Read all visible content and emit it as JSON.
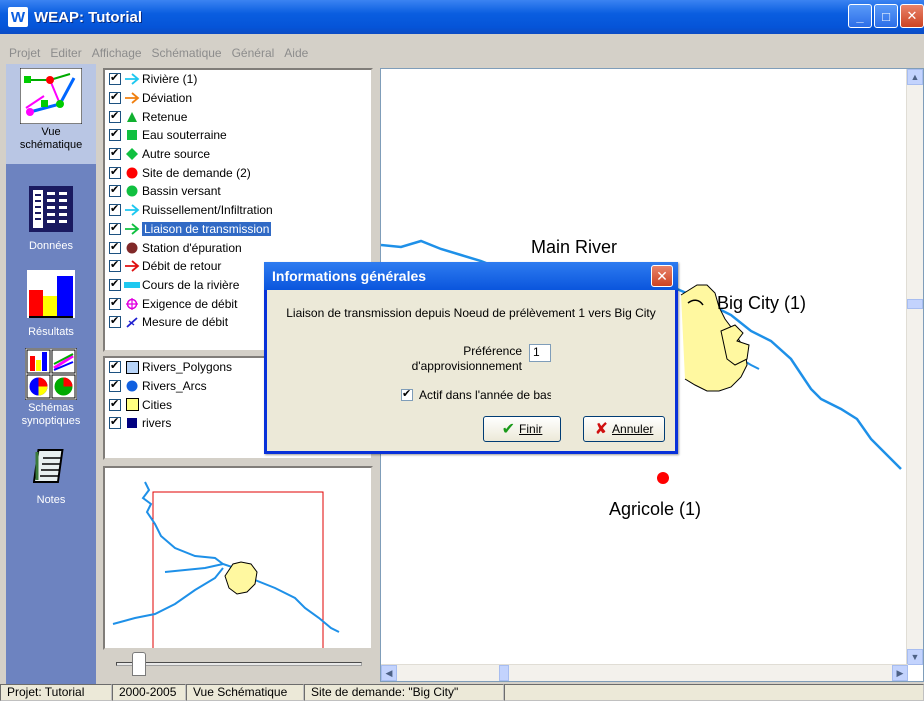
{
  "window": {
    "title": "WEAP: Tutorial",
    "app_icon": "W"
  },
  "menu": [
    "Projet",
    "Editer",
    "Affichage",
    "Schématique",
    "Général",
    "Aide"
  ],
  "nav": [
    {
      "label": "Vue\nschématique",
      "icon": "schematic-icon"
    },
    {
      "label": "Données",
      "icon": "data-icon"
    },
    {
      "label": "Résultats",
      "icon": "results-icon"
    },
    {
      "label": "Schémas\nsynoptiques",
      "icon": "overviews-icon"
    },
    {
      "label": "Notes",
      "icon": "notes-icon"
    }
  ],
  "legend_items": [
    {
      "label": "Rivière (1)",
      "icon": "arrow-cyan"
    },
    {
      "label": "Déviation",
      "icon": "arrow-orange"
    },
    {
      "label": "Retenue",
      "icon": "triangle-green"
    },
    {
      "label": "Eau souterraine",
      "icon": "square-green"
    },
    {
      "label": "Autre source",
      "icon": "diamond-green"
    },
    {
      "label": "Site de demande (2)",
      "icon": "circle-red"
    },
    {
      "label": "Bassin versant",
      "icon": "circle-green"
    },
    {
      "label": "Ruissellement/Infiltration",
      "icon": "arrow-cyan"
    },
    {
      "label": "Liaison de transmission",
      "icon": "arrow-green",
      "selected": true
    },
    {
      "label": "Station d'épuration",
      "icon": "circle-brown"
    },
    {
      "label": "Débit de retour",
      "icon": "arrow-red"
    },
    {
      "label": "Cours de la rivière",
      "icon": "bar-cyan"
    },
    {
      "label": "Exigence de débit",
      "icon": "flow-req-magenta"
    },
    {
      "label": "Mesure de débit",
      "icon": "gauge-blue"
    }
  ],
  "layer_items": [
    {
      "label": "Rivers_Polygons",
      "icon": "square-lightblue"
    },
    {
      "label": "Rivers_Arcs",
      "icon": "circle-blue"
    },
    {
      "label": "Cities",
      "icon": "square-yellow"
    },
    {
      "label": "rivers",
      "icon": "square-navy"
    }
  ],
  "map": {
    "labels": {
      "main_river": "Main River",
      "big_city": "Big City (1)",
      "agricole": "Agricole (1)"
    },
    "colors": {
      "river": "#1e90e8",
      "city": "#fff8a0",
      "demand_site": "#ff0000"
    }
  },
  "dialog": {
    "title": "Informations générales",
    "description": "Liaison de transmission depuis Noeud de prélèvement 1 vers Big City",
    "pref_label": "Préférence d'approvisionnement",
    "pref_value": "1",
    "active_label": "Actif dans l'année de base",
    "finish_label": "Finir",
    "cancel_label": "Annuler"
  },
  "status": [
    "Projet: Tutorial",
    "2000-2005",
    "Vue Schématique",
    "Site de demande: \"Big City\""
  ]
}
